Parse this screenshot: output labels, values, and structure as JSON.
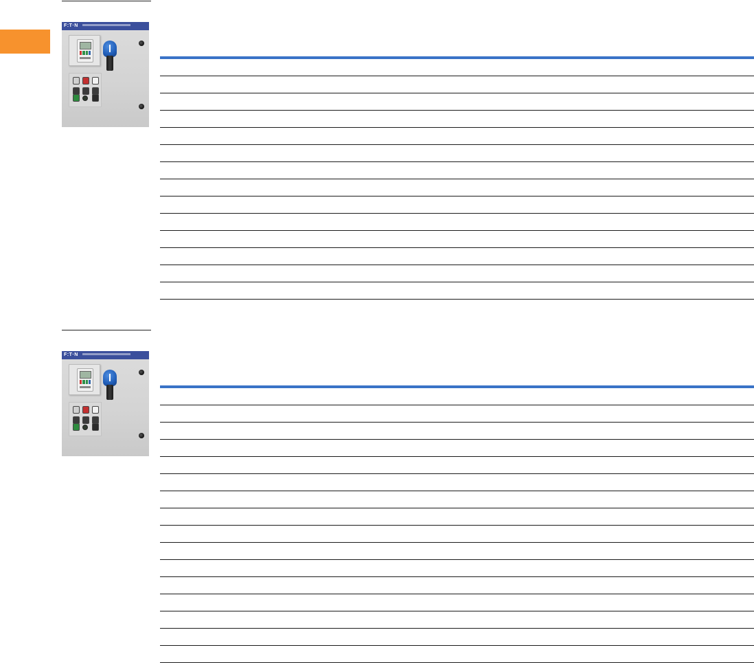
{
  "page": {
    "accent_color": "#f7922d",
    "table_rule_color": "#3a73c7"
  },
  "sections": [
    {
      "panel": {
        "brand_logo_text": "F:T·N"
      },
      "table": {
        "row_count": 14
      }
    },
    {
      "panel": {
        "brand_logo_text": "F:T·N"
      },
      "table": {
        "row_count": 16
      }
    }
  ]
}
